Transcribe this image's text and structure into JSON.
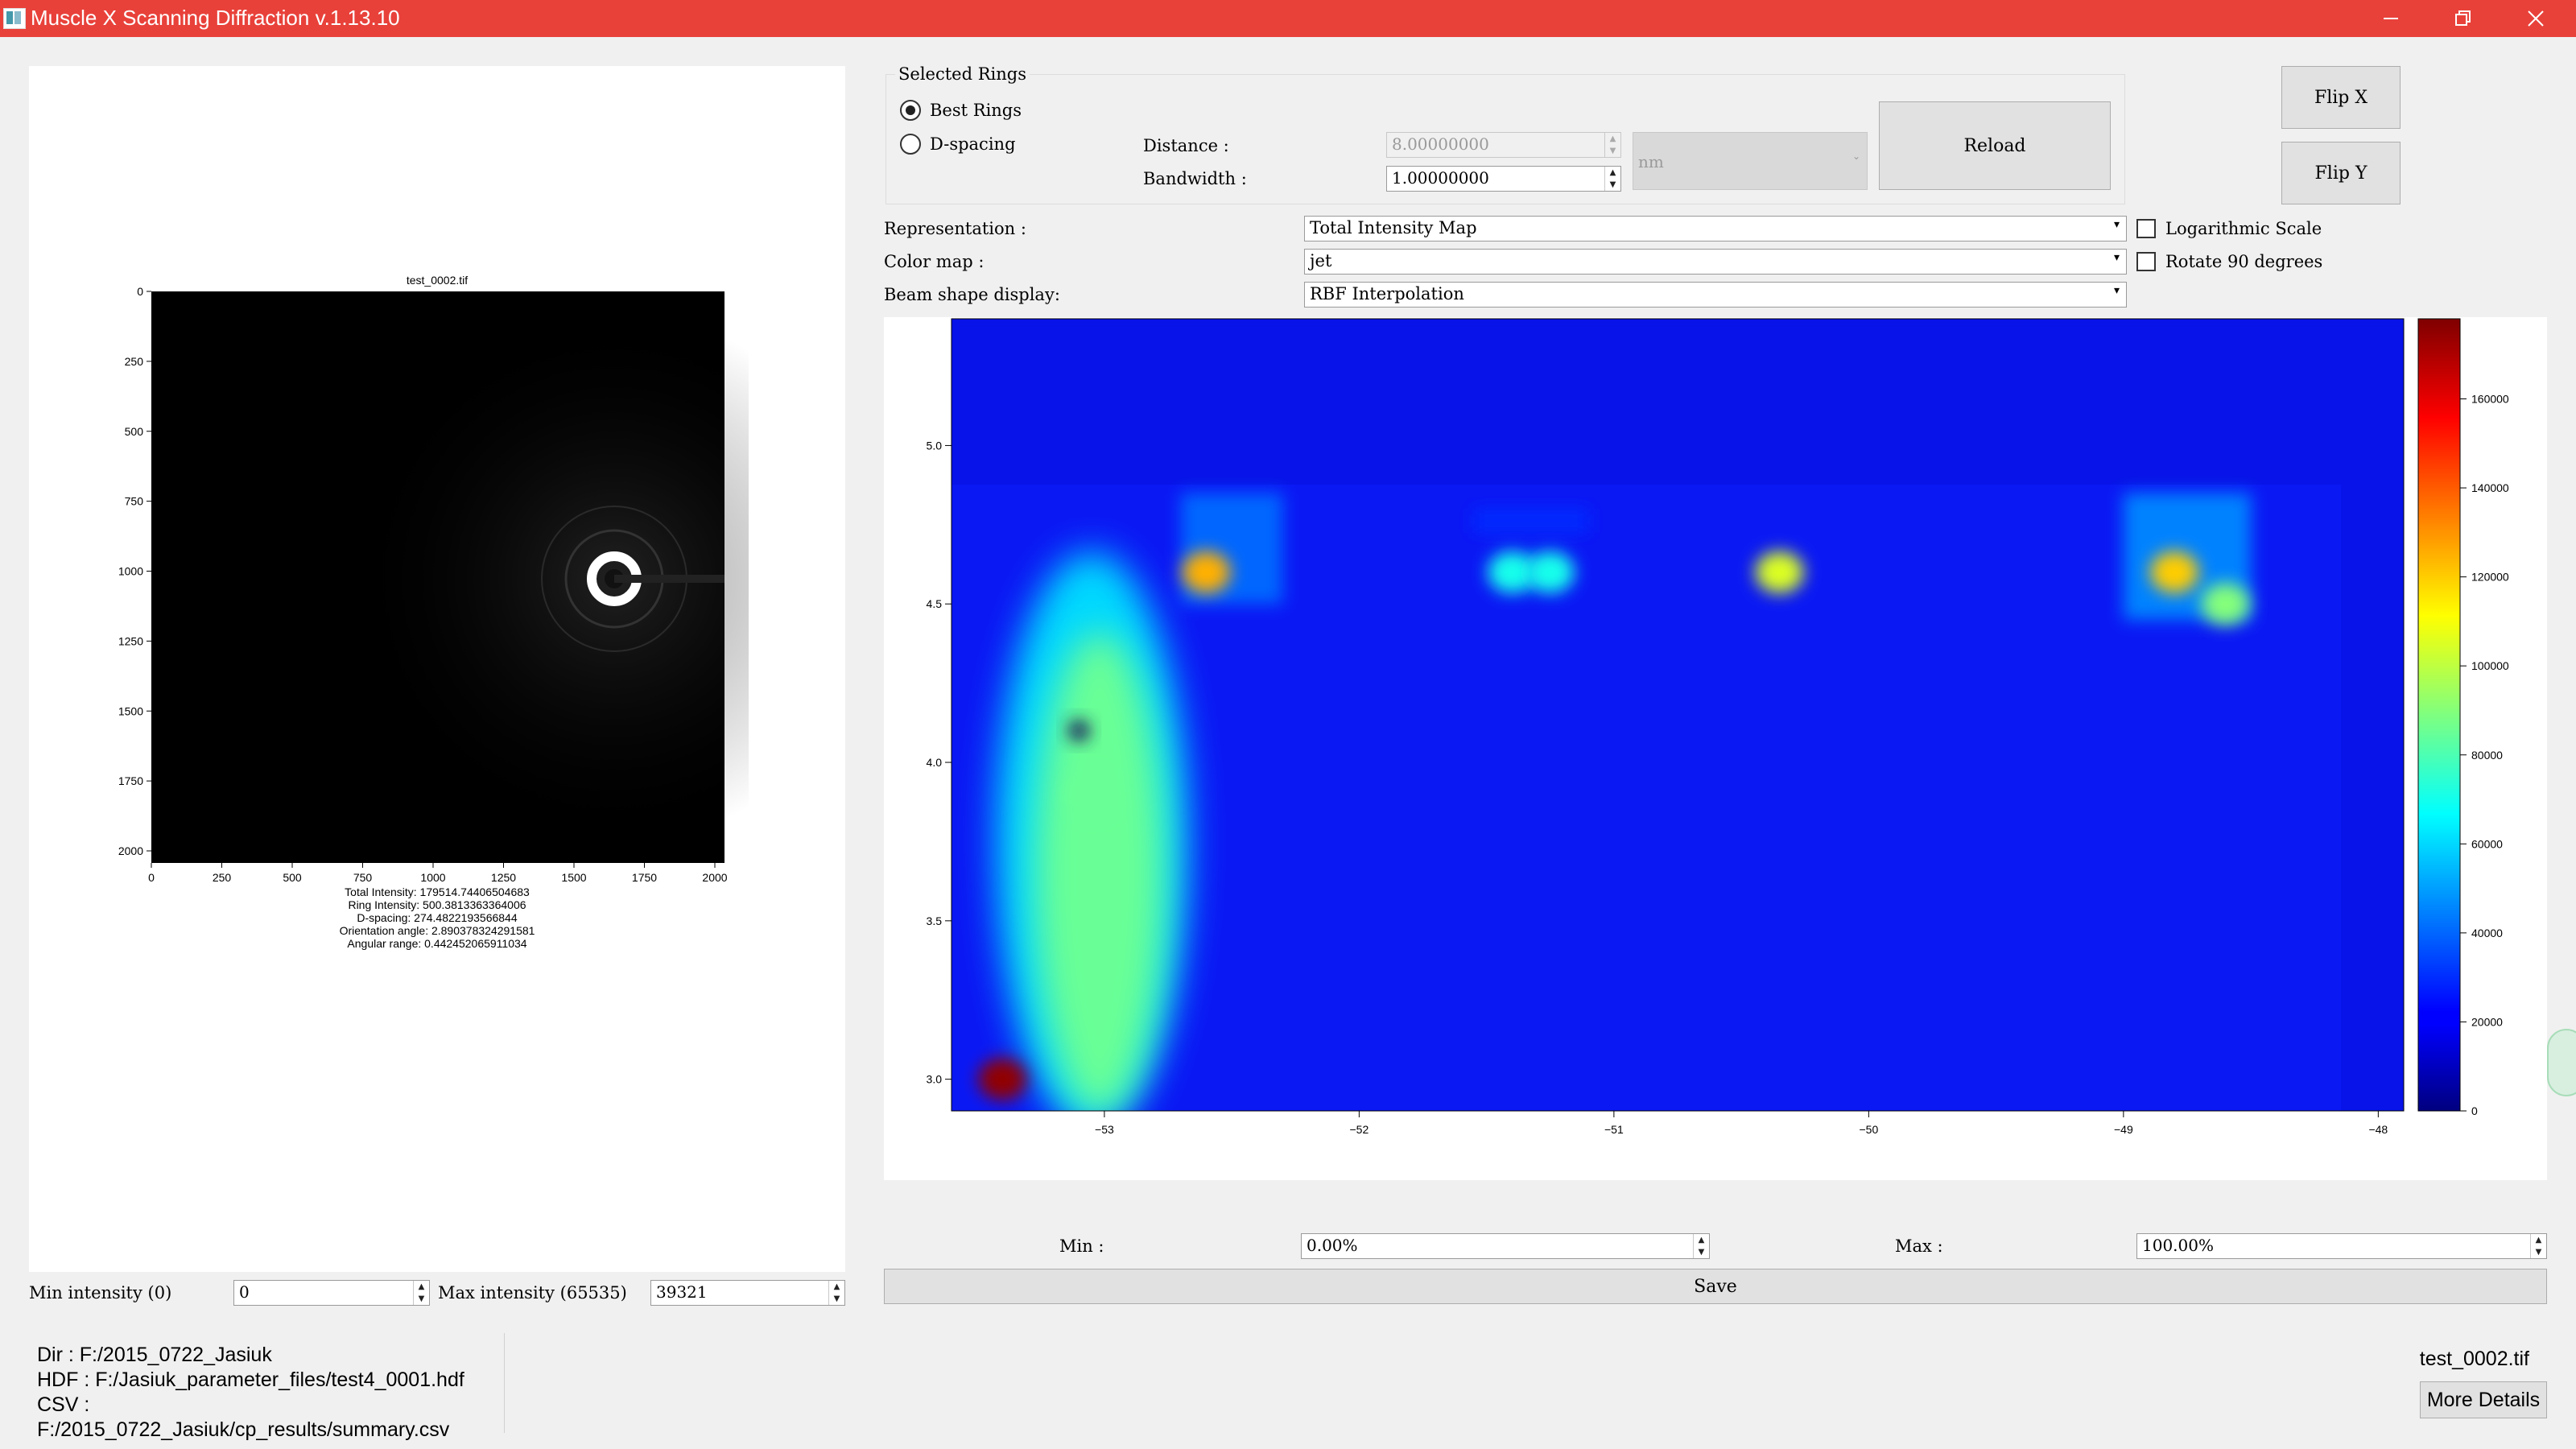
{
  "window": {
    "title": "Muscle X Scanning Diffraction v.1.13.10",
    "controls": [
      "minimize-icon",
      "restore-icon",
      "close-icon"
    ]
  },
  "image_panel": {
    "plot_title": "test_0002.tif",
    "y_ticks": [
      "0",
      "250",
      "500",
      "750",
      "1000",
      "1250",
      "1500",
      "1750",
      "2000"
    ],
    "x_ticks": [
      "0",
      "250",
      "500",
      "750",
      "1000",
      "1250",
      "1500",
      "1750",
      "2000"
    ],
    "info": {
      "total_intensity": "Total Intensity: 179514.74406504683",
      "ring_intensity": "Ring Intensity: 500.3813363364006",
      "d_spacing": "D-spacing: 274.4822193566844",
      "orientation": "Orientation angle: 2.890378324291581",
      "angular_range": "Angular range: 0.442452065911034"
    },
    "min_intensity_label": "Min intensity (0)",
    "min_intensity_value": "0",
    "max_intensity_label": "Max intensity (65535)",
    "max_intensity_value": "39321"
  },
  "selected_rings": {
    "group_title": "Selected Rings",
    "best_rings_label": "Best Rings",
    "best_rings_checked": true,
    "d_spacing_label": "D-spacing",
    "d_spacing_checked": false,
    "distance_label": "Distance :",
    "distance_value": "8.00000000",
    "bandwidth_label": "Bandwidth :",
    "bandwidth_value": "1.00000000",
    "unit_value": "nm",
    "reload_label": "Reload"
  },
  "flip_x_label": "Flip X",
  "flip_y_label": "Flip Y",
  "representation": {
    "label": "Representation :",
    "value": "Total Intensity Map"
  },
  "color_map": {
    "label": "Color map :",
    "value": "jet"
  },
  "beam_shape": {
    "label": "Beam shape display:",
    "value": "RBF Interpolation"
  },
  "log_scale": {
    "label": "Logarithmic Scale",
    "checked": false
  },
  "rotate90": {
    "label": "Rotate 90 degrees",
    "checked": false
  },
  "chart_data": {
    "type": "heatmap",
    "colormap": "jet",
    "x_ticks": [
      "−53",
      "−52",
      "−51",
      "−50",
      "−49",
      "−48"
    ],
    "y_ticks": [
      "5.0",
      "4.5",
      "4.0",
      "3.5",
      "3.0"
    ],
    "xlim": [
      -53.6,
      -47.9
    ],
    "ylim": [
      2.9,
      5.4
    ],
    "colorbar_ticks": [
      "0",
      "20000",
      "40000",
      "60000",
      "80000",
      "100000",
      "120000",
      "140000",
      "160000"
    ],
    "colorbar_range": [
      0,
      178000
    ],
    "background": 18000,
    "hotspots": [
      {
        "x": -53.4,
        "y": 3.0,
        "value": 175000
      },
      {
        "x": -53.05,
        "y": 3.9,
        "value": 85000
      },
      {
        "x": -52.6,
        "y": 4.6,
        "value": 125000
      },
      {
        "x": -51.4,
        "y": 4.6,
        "value": 70000
      },
      {
        "x": -51.25,
        "y": 4.6,
        "value": 70000
      },
      {
        "x": -50.35,
        "y": 4.6,
        "value": 105000
      },
      {
        "x": -48.8,
        "y": 4.6,
        "value": 120000
      },
      {
        "x": -48.6,
        "y": 4.5,
        "value": 90000
      }
    ]
  },
  "range": {
    "min_label": "Min :",
    "min_value": "0.00%",
    "max_label": "Max :",
    "max_value": "100.00%",
    "save_label": "Save"
  },
  "status": {
    "dir": "Dir : F:/2015_0722_Jasiuk",
    "hdf": "HDF : F:/Jasiuk_parameter_files/test4_0001.hdf",
    "csv": "CSV : F:/2015_0722_Jasiuk/cp_results/summary.csv",
    "current_file": "test_0002.tif",
    "more_details_label": "More Details"
  }
}
